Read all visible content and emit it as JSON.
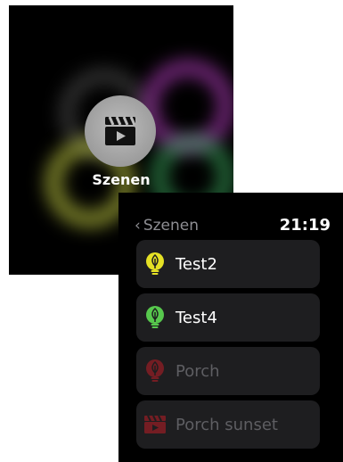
{
  "glance": {
    "title": "Szenen",
    "icon": "clapperboard-icon"
  },
  "list": {
    "back_label": "Szenen",
    "time": "21:19",
    "items": [
      {
        "label": "Test2",
        "icon": "bulb-icon",
        "state": "on",
        "color": "#e5e125"
      },
      {
        "label": "Test4",
        "icon": "bulb-icon",
        "state": "on",
        "color": "#57c84d"
      },
      {
        "label": "Porch",
        "icon": "bulb-icon",
        "state": "off",
        "color": "#8a1d24"
      },
      {
        "label": "Porch sunset",
        "icon": "clapperboard-icon",
        "state": "off",
        "color": "#8a1d24"
      }
    ]
  }
}
